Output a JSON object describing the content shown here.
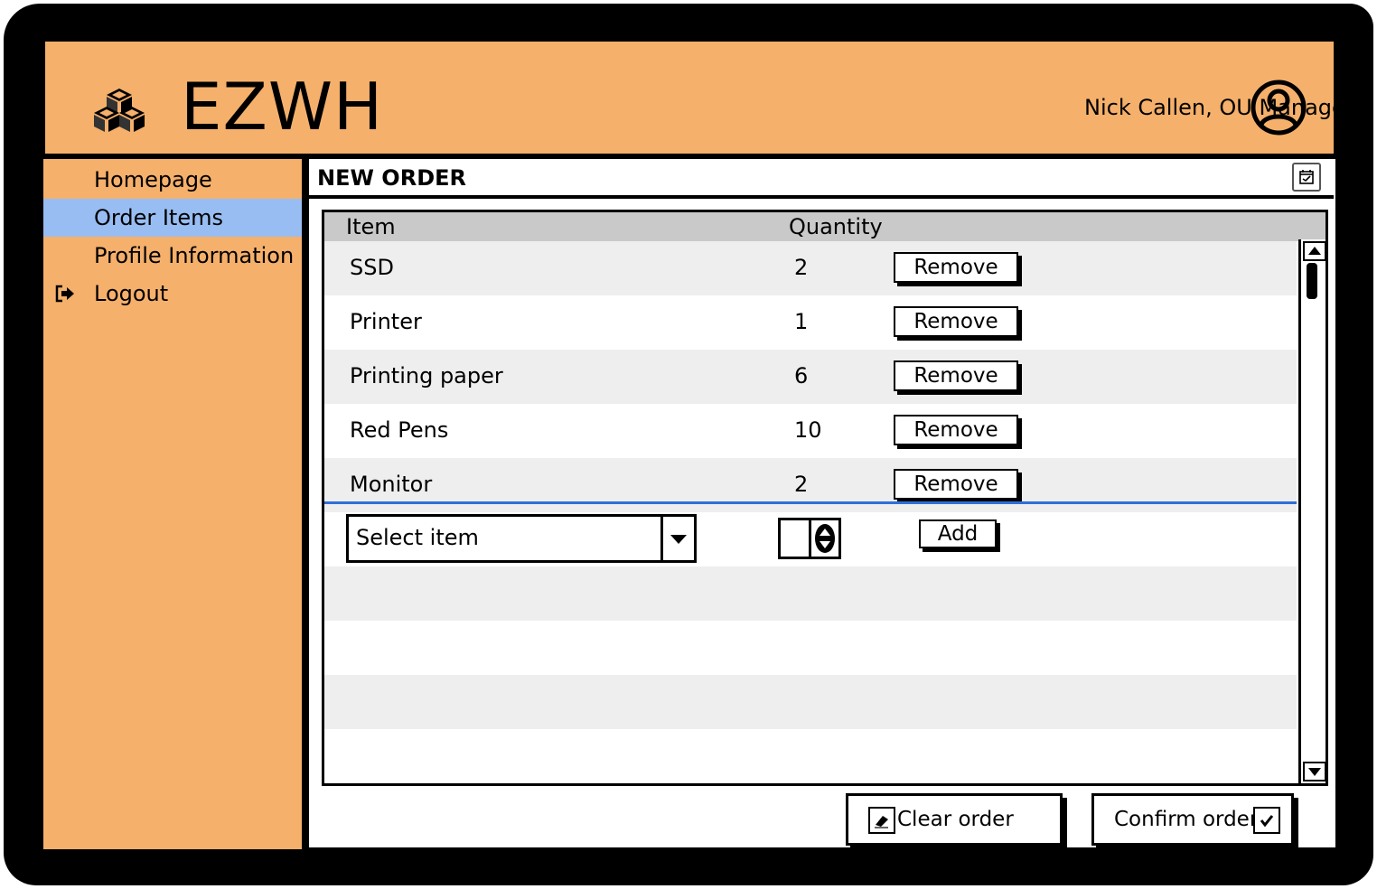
{
  "app": {
    "title": "EZWH",
    "user": "Nick Callen, OU Manager"
  },
  "sidebar": {
    "items": [
      {
        "label": "Homepage"
      },
      {
        "label": "Order Items"
      },
      {
        "label": "Profile Information"
      },
      {
        "label": "Logout"
      }
    ]
  },
  "panel": {
    "title": "NEW ORDER"
  },
  "table": {
    "headers": {
      "item": "Item",
      "quantity": "Quantity"
    },
    "rows": [
      {
        "item": "SSD",
        "quantity": "2",
        "action": "Remove"
      },
      {
        "item": "Printer",
        "quantity": "1",
        "action": "Remove"
      },
      {
        "item": "Printing paper",
        "quantity": "6",
        "action": "Remove"
      },
      {
        "item": "Red Pens",
        "quantity": "10",
        "action": "Remove"
      },
      {
        "item": "Monitor",
        "quantity": "2",
        "action": "Remove"
      }
    ]
  },
  "add_row": {
    "select_value": "Select item",
    "add_label": "Add"
  },
  "actions": {
    "clear": "Clear order",
    "confirm": "Confirm order"
  },
  "colors": {
    "accent": "#f5b06b",
    "selected": "#98bdf2",
    "divider": "#2f6fd8"
  },
  "icons": [
    "cubes-icon",
    "user-avatar-icon",
    "logout-icon",
    "calendar-icon",
    "chevron-down-icon",
    "stepper-icon",
    "eraser-icon",
    "checkbox-check-icon"
  ]
}
